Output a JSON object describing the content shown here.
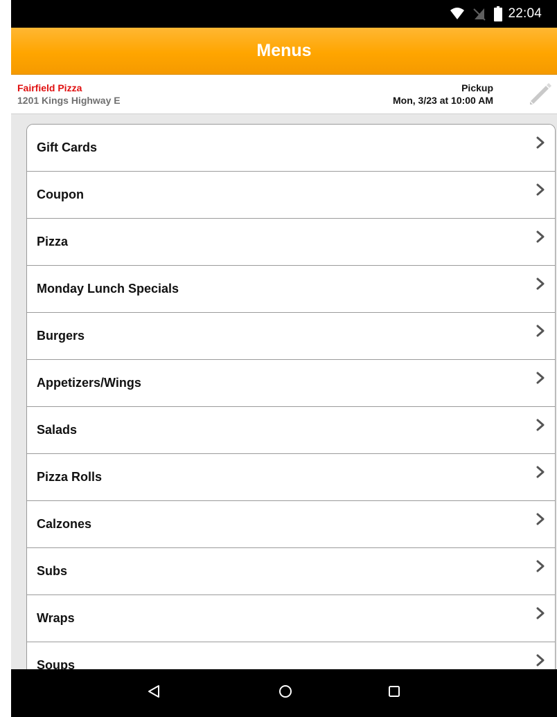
{
  "status_bar": {
    "time": "22:04",
    "icons": [
      "wifi-icon",
      "no-sim-icon",
      "battery-icon"
    ]
  },
  "header": {
    "title": "Menus",
    "accent_color": "#ffa500"
  },
  "store_info": {
    "name": "Fairfield Pizza",
    "name_color": "#e01010",
    "address": "1201 Kings Highway E",
    "order_type": "Pickup",
    "order_time": "Mon, 3/23 at 10:00 AM",
    "edit_icon": "pencil-icon"
  },
  "menu": {
    "chevron_icon": "chevron-right-icon",
    "items": [
      {
        "label": "Gift Cards"
      },
      {
        "label": "Coupon"
      },
      {
        "label": "Pizza"
      },
      {
        "label": "Monday Lunch Specials"
      },
      {
        "label": "Burgers"
      },
      {
        "label": "Appetizers/Wings"
      },
      {
        "label": "Salads"
      },
      {
        "label": "Pizza Rolls"
      },
      {
        "label": "Calzones"
      },
      {
        "label": "Subs"
      },
      {
        "label": "Wraps"
      },
      {
        "label": "Soups"
      }
    ]
  },
  "nav_bar": {
    "buttons": [
      "back-icon",
      "home-icon",
      "recents-icon"
    ]
  }
}
